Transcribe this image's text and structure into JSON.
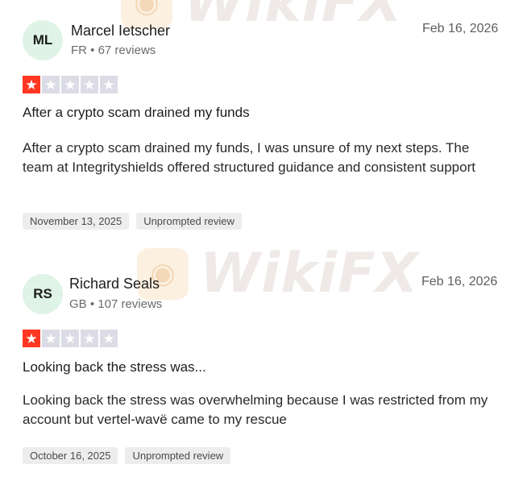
{
  "watermark": {
    "text": "WikiFX"
  },
  "reviews": [
    {
      "initials": "ML",
      "name": "Marcel Ietscher",
      "meta": "FR • 67 reviews",
      "date": "Feb 16, 2026",
      "rating": 1,
      "title": "After a crypto scam drained my funds",
      "body": "After a crypto scam drained my funds, I was unsure of my next steps. The team at Integrityshields offered structured guidance and consistent support",
      "experience_date": "November 13, 2025",
      "badge": "Unprompted review"
    },
    {
      "initials": "RS",
      "name": "Richard Seals",
      "meta": "GB • 107 reviews",
      "date": "Feb 16, 2026",
      "rating": 1,
      "title": "Looking back the stress was...",
      "body": "Looking back the stress was overwhelming because I was restricted from my account but vertel-wavë came to my rescue",
      "experience_date": "October 16, 2025",
      "badge": "Unprompted review"
    }
  ],
  "colors": {
    "star_on": "#ff3722",
    "star_off": "#dcdce6",
    "avatar_bg": "#dff3e6"
  }
}
